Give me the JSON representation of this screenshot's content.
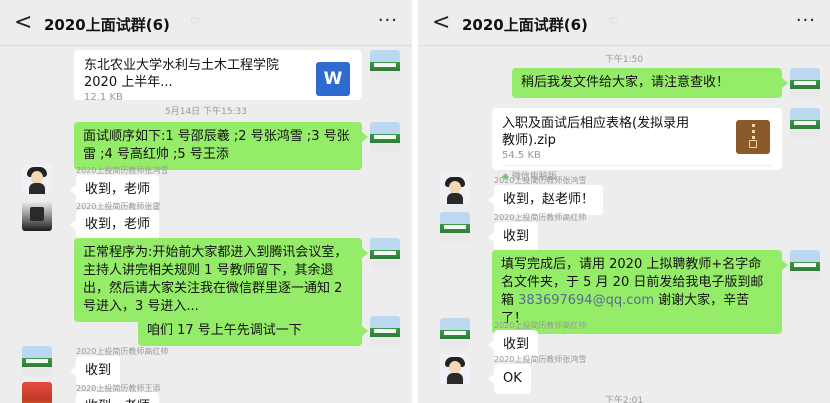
{
  "left": {
    "header": {
      "back": "<",
      "title": "2020上面试群(6)",
      "more": "···"
    },
    "file": {
      "name": "东北农业大学水利与土木工程学院 2020 上半年...",
      "size": "12.1 KB",
      "icon": "W"
    },
    "timestamp": "5月14日 下午15:33",
    "msg_order": "面试顺序如下:1 号邵辰羲 ;2 号张鸿雪 ;3 号张雷 ;4 号高红帅 ;5 号王添",
    "sender_1": "2020上投简历教师张鸿雪",
    "reply_1": "收到，老师",
    "sender_2": "2020上投简历教师张雷",
    "reply_2": "收到，老师",
    "msg_procedure": "正常程序为:开始前大家都进入到腾讯会议室，主持人讲完相关规则 1 号教师留下，其余退出，然后请大家关注我在微信群里逐一通知 2 号进入，3 号进入...",
    "msg_debug": "咱们 17 号上午先调试一下",
    "sender_3": "2020上投简历教师高红帅",
    "reply_3": "收到",
    "sender_4": "2020上投简历教师王添",
    "reply_4": "收到，老师"
  },
  "right": {
    "header": {
      "back": "<",
      "title": "2020上面试群(6)",
      "more": "···"
    },
    "timestamp_1": "下午1:50",
    "msg_notice": "稍后我发文件给大家，请注意查收！",
    "file": {
      "name": "入职及面试后相应表格(发拟录用教师).zip",
      "size": "54.5 KB",
      "source": "微信电脑版"
    },
    "sender_1": "2020上投简历教师张鸿雪",
    "reply_1": "收到，赵老师！",
    "sender_2": "2020上投简历教师高红帅",
    "reply_2": "收到",
    "msg_fill_1": "填写完成后，请用 2020 上拟聘教师+名字命名文件夹，于 5 月 20 日前发给我电子版到邮箱 ",
    "email": "383697694@qq.com",
    "msg_fill_2": " 谢谢大家，辛苦了！",
    "sender_3": "2020上投简历教师高红帅",
    "reply_3": "收到",
    "sender_4": "2020上投简历教师张鸿雪",
    "reply_4": "OK",
    "timestamp_2": "下午2:01"
  },
  "colors": {
    "my_bubble": "#95ec69",
    "other_bubble": "#ffffff",
    "background": "#ededed",
    "link": "#576b95"
  },
  "icons": [
    "back-arrow-icon",
    "mute-bell-icon",
    "more-options-icon",
    "word-file-icon",
    "zip-file-icon",
    "wechat-pc-icon"
  ]
}
